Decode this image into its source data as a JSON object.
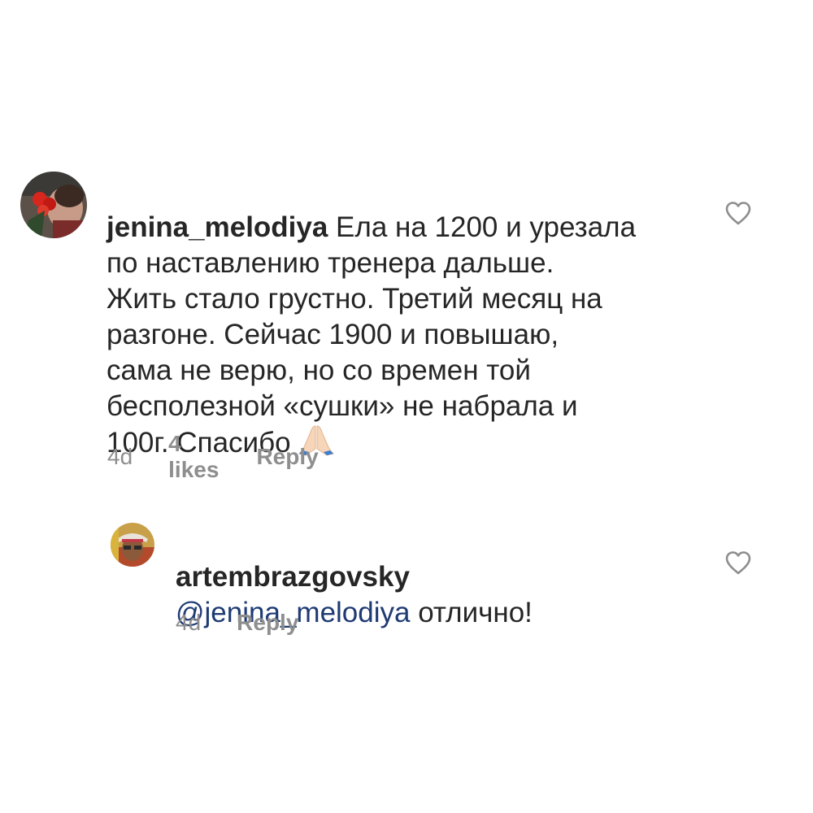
{
  "comments": [
    {
      "username": "jenina_melodiya",
      "text_line1": " Ела на 1200 и урезала",
      "text_rest": "по наставлению тренера дальше.\nЖить стало грустно. Третий месяц на\nразгоне. Сейчас 1900 и повышаю,\nсама не верю, но со времен той\nбесполезной «сушки» не набрала и\n100г. Спасибо",
      "emoji": "folded-hands-icon",
      "time": "4d",
      "likes": "4 likes",
      "reply": "Reply"
    },
    {
      "username": "artembrazgovsky",
      "mention": "@jenina_melodiya",
      "text": " отлично!",
      "time": "4d",
      "reply": "Reply"
    }
  ],
  "colors": {
    "text": "#262626",
    "secondary": "#8e8e8e",
    "mention": "#1f3b73"
  }
}
